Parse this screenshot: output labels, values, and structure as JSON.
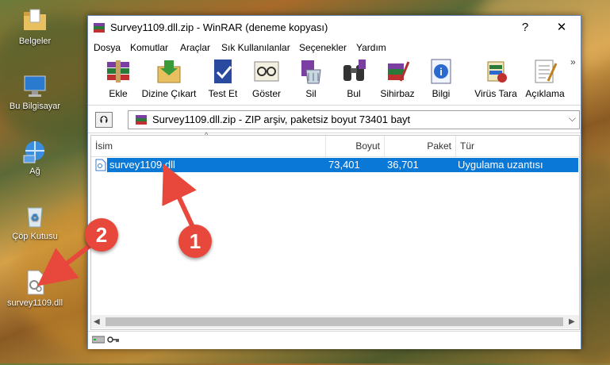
{
  "desktop": {
    "icons": [
      {
        "label": "Belgeler",
        "icon": "folder-documents-icon"
      },
      {
        "label": "Bu Bilgisayar",
        "icon": "computer-icon"
      },
      {
        "label": "Ağ",
        "icon": "network-icon"
      },
      {
        "label": "Çöp Kutusu",
        "icon": "recycle-bin-icon"
      },
      {
        "label": "survey1109.dll",
        "icon": "dll-file-icon"
      }
    ]
  },
  "window": {
    "title": "Survey1109.dll.zip - WinRAR (deneme kopyası)",
    "help": "?",
    "close": "✕",
    "menu": [
      "Dosya",
      "Komutlar",
      "Araçlar",
      "Sık Kullanılanlar",
      "Seçenekler",
      "Yardım"
    ],
    "toolbar": [
      {
        "label": "Ekle",
        "icon": "add-books-icon"
      },
      {
        "label": "Dizine Çıkart",
        "icon": "extract-folder-icon"
      },
      {
        "label": "Test Et",
        "icon": "test-check-icon"
      },
      {
        "label": "Göster",
        "icon": "view-glasses-icon"
      },
      {
        "label": "Sil",
        "icon": "delete-icon"
      },
      {
        "label": "Bul",
        "icon": "find-binoculars-icon"
      },
      {
        "label": "Sihirbaz",
        "icon": "wizard-icon"
      },
      {
        "label": "Bilgi",
        "icon": "info-icon"
      },
      {
        "label": "Virüs Tara",
        "icon": "virus-scan-icon"
      },
      {
        "label": "Açıklama",
        "icon": "comment-icon"
      }
    ],
    "overflow": "»",
    "address": "Survey1109.dll.zip - ZIP arşiv, paketsiz boyut 73401 bayt",
    "columns": [
      "İsim",
      "Boyut",
      "Paket",
      "Tür"
    ],
    "files": [
      {
        "name": "survey1109.dll",
        "size": "73,401",
        "packed": "36,701",
        "type": "Uygulama uzantısı"
      }
    ]
  },
  "annotations": [
    "1",
    "2"
  ],
  "colors": {
    "selection": "#0a78d7",
    "badge": "#e8483c"
  }
}
